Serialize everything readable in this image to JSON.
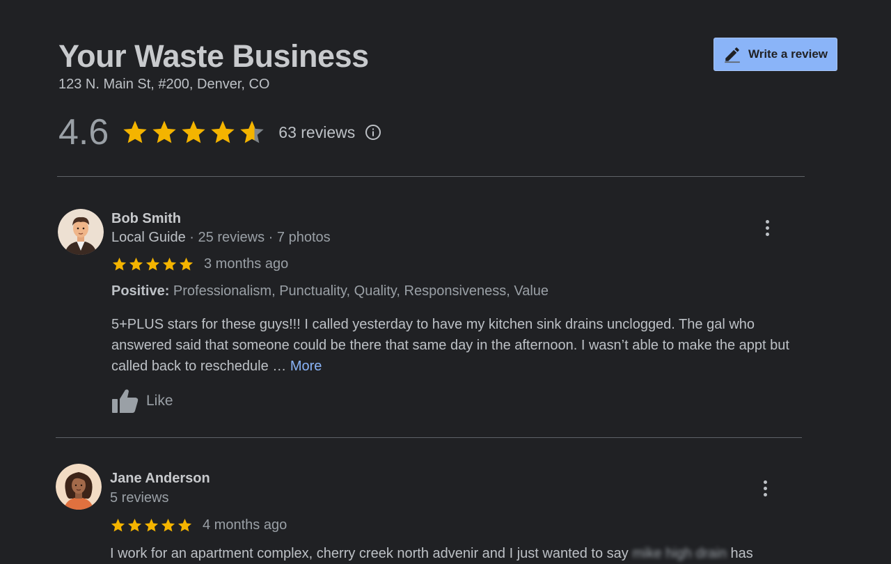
{
  "business": {
    "name": "Your Waste Business",
    "address": "123 N. Main St, #200, Denver, CO",
    "write_review_label": "Write a review",
    "rating": "4.6",
    "rating_value": 4.6,
    "review_count": "63 reviews"
  },
  "colors": {
    "star": "#f4b400",
    "star_empty": "#80868b",
    "accent": "#8ab4f8"
  },
  "reviews": [
    {
      "name": "Bob Smith",
      "guide": "Local Guide",
      "meta": " · 25 reviews · 7 photos",
      "stars": 5,
      "time": "3 months ago",
      "positive_label": "Positive:",
      "positive_text": " Professionalism, Punctuality, Quality, Responsiveness, Value",
      "text": "5+PLUS stars for these guys!!! I called yesterday to have my kitchen sink drains unclogged.  The gal who answered said that someone could be there that same day in the afternoon.  I wasn’t able to make the appt but called back to reschedule … ",
      "more": "More",
      "like": "Like"
    },
    {
      "name": "Jane Anderson",
      "meta": "5 reviews",
      "stars": 5,
      "time": "4 months ago",
      "text": "I work for an apartment complex, cherry creek north advenir and I just wanted to say ",
      "text_blurred": "mike high drain",
      "text_tail": " has"
    }
  ]
}
